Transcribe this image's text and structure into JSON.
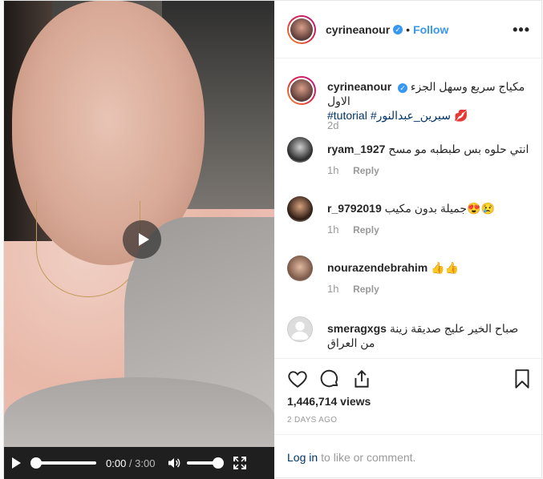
{
  "header": {
    "username": "cyrineanour",
    "follow_label": "Follow",
    "dot": "•",
    "more": "•••"
  },
  "video": {
    "time_current": "0:00",
    "time_separator": " / ",
    "time_duration": "3:00",
    "progress": 0,
    "volume": 1
  },
  "caption": {
    "username": "cyrineanour",
    "text": "مكياج سريع وسهل الجزء الاول",
    "hashtag1": "#سيرين_عبدالنور",
    "hashtag2": "#tutorial",
    "emoji": "💋",
    "age": "2d"
  },
  "comments": [
    {
      "username": "ryam_1927",
      "text": "انتي حلوه بس طبطبه مو مسح",
      "age": "1h",
      "reply": "Reply"
    },
    {
      "username": "r_9792019",
      "text": "جميلة بدون مكيب😍😢",
      "age": "1h",
      "reply": "Reply"
    },
    {
      "username": "nourazendebrahim",
      "text": "👍👍",
      "age": "1h",
      "reply": "Reply"
    },
    {
      "username": "smeragxgs",
      "text": "صباح الخير عليج صديقة زينة من العراق",
      "age": "",
      "reply": ""
    }
  ],
  "stats": {
    "views": "1,446,714 views",
    "date": "2 DAYS AGO"
  },
  "login": {
    "link": "Log in",
    "text": "to like or comment."
  },
  "icons": [
    "play-icon",
    "volume-icon",
    "fullscreen-icon",
    "heart-icon",
    "comment-icon",
    "share-icon",
    "bookmark-icon",
    "verified-icon",
    "more-icon"
  ],
  "colors": {
    "accent": "#3897f0",
    "link": "#003569",
    "muted": "#999999"
  }
}
